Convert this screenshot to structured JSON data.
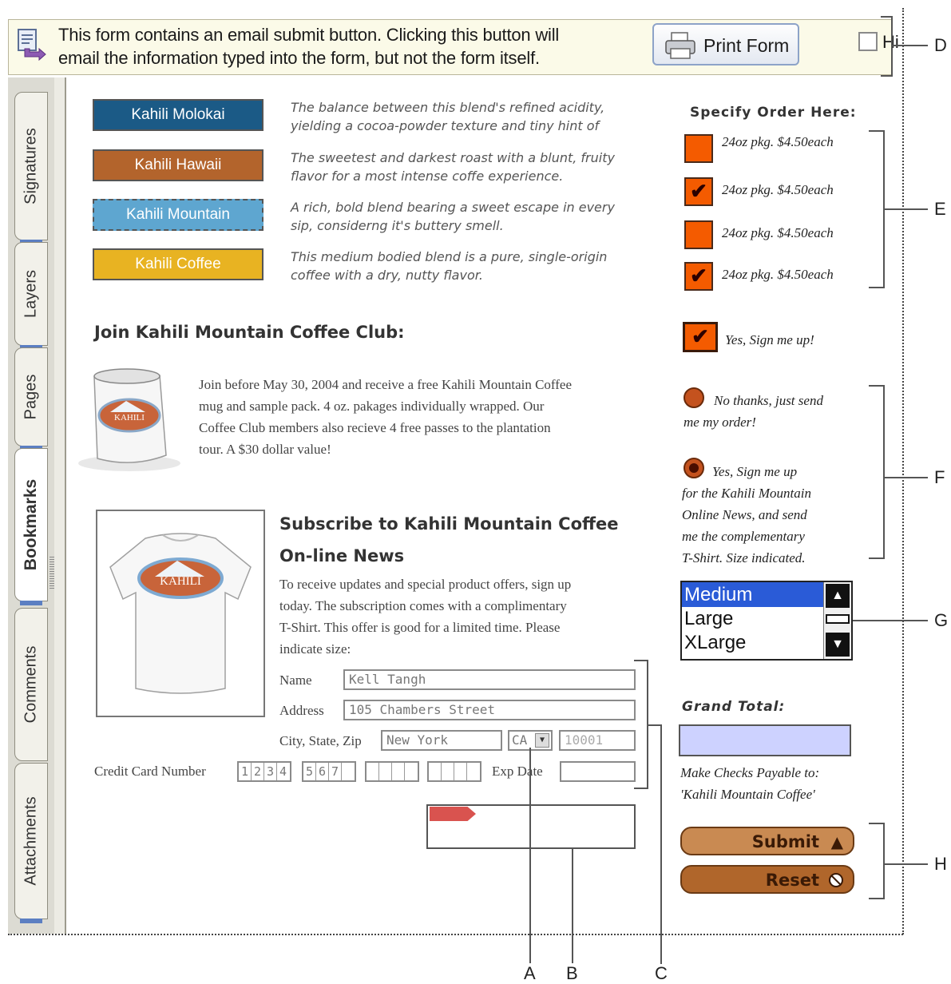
{
  "message_bar": {
    "text_line1": "This form contains an email submit button. Clicking this button will",
    "text_line2": "email the information typed into the form, but not the form itself.",
    "print_button_label": "Print Form",
    "hide_label": "Hi"
  },
  "nav_tabs": [
    "Signatures",
    "Layers",
    "Pages",
    "Bookmarks",
    "Comments",
    "Attachments"
  ],
  "blends": [
    {
      "label": "Kahili Molokai",
      "color": "#1b5a86",
      "desc1": "The balance between this blend's refined acidity,",
      "desc2": "yielding a cocoa-powder texture and tiny hint of"
    },
    {
      "label": "Kahili Hawaii",
      "color": "#b3642c",
      "desc1": "The sweetest and darkest roast with a blunt, fruity",
      "desc2": "flavor for a most intense coffe experience."
    },
    {
      "label": "Kahili Mountain",
      "color": "#5ea6d0",
      "desc1": "A rich, bold blend bearing a sweet escape in every",
      "desc2": "sip, considerng it's buttery smell."
    },
    {
      "label": "Kahili Coffee",
      "color": "#e8b322",
      "desc1": "This medium bodied blend is a pure, single-origin",
      "desc2": "coffee with a dry, nutty flavor."
    }
  ],
  "order": {
    "title": "Specify Order Here:",
    "options": [
      {
        "label": "24oz pkg. $4.50each",
        "checked": ""
      },
      {
        "label": "24oz pkg. $4.50each",
        "checked": "✔"
      },
      {
        "label": "24oz pkg. $4.50each",
        "checked": ""
      },
      {
        "label": "24oz pkg. $4.50each",
        "checked": "✔"
      }
    ],
    "signup_mark": "✔",
    "signup_label": "Yes, Sign me up!"
  },
  "club": {
    "heading": "Join Kahili Mountain Coffee Club:",
    "line1": "Join before May 30, 2004 and receive a free Kahili Mountain Coffee",
    "line2": "mug and sample pack. 4 oz. pakages individually wrapped. Our",
    "line3": "Coffee Club members also recieve 4 free passes to the plantation",
    "line4": "tour. A $30 dollar value!",
    "logo_text": "KAHILI"
  },
  "radios": {
    "no_line1": "No thanks, just send",
    "no_line2": "me my order!",
    "yes_line1": "Yes, Sign me up",
    "yes_line2": "for the Kahili Mountain",
    "yes_line3": "Online News, and send",
    "yes_line4": "me the complementary",
    "yes_line5": "T-Shirt. Size indicated."
  },
  "sizes": {
    "options": [
      "Medium",
      "Large",
      "XLarge"
    ],
    "selected": "Medium"
  },
  "subscribe": {
    "heading1": "Subscribe to Kahili Mountain Coffee",
    "heading2": "On-line News",
    "line1": "To receive updates and special product offers, sign up",
    "line2": "today. The subscription comes with a complimentary",
    "line3": "T-Shirt. This offer is good for a limited time. Please",
    "line4": "indicate size:"
  },
  "form": {
    "name_label": "Name",
    "name_value": "Kell Tangh",
    "address_label": "Address",
    "address_value": "105 Chambers Street",
    "csz_label": "City, State, Zip",
    "city_value": "New York",
    "state_value": "CA",
    "zip_value": "10001",
    "cc_label": "Credit Card Number",
    "cc_group1": [
      "1",
      "2",
      "3",
      "4"
    ],
    "cc_group2": [
      "5",
      "6",
      "7",
      ""
    ],
    "exp_label": "Exp Date"
  },
  "grand_total": {
    "label": "Grand Total:",
    "payable_line1": "Make Checks Payable to:",
    "payable_line2": "'Kahili Mountain Coffee'"
  },
  "buttons": {
    "submit": "Submit",
    "reset": "Reset"
  },
  "callouts": [
    "A",
    "B",
    "C",
    "D",
    "E",
    "F",
    "G",
    "H"
  ],
  "colors": {
    "order_box": "#f45b00",
    "total_field": "#cdd2ff",
    "list_selected": "#2a5bd7",
    "button_fill": "#c98a52"
  }
}
